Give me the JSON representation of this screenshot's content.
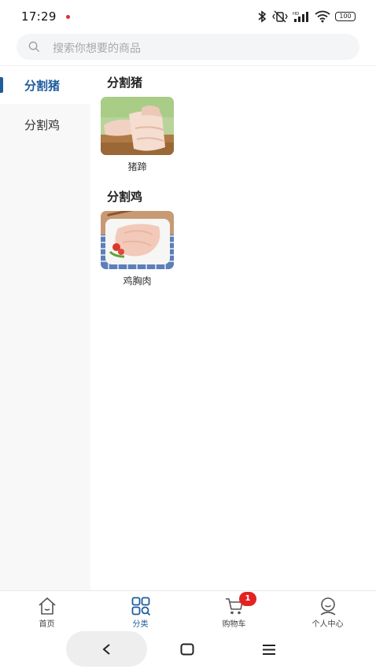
{
  "status_bar": {
    "time": "17:29",
    "battery": "100",
    "icons": [
      "bluetooth-icon",
      "vibrate-off-icon",
      "hd-signal-icon",
      "wifi-icon",
      "battery-icon"
    ],
    "notification_dot_color": "#e0302b"
  },
  "search": {
    "placeholder": "搜索你想要的商品"
  },
  "sidebar": {
    "items": [
      {
        "label": "分割猪",
        "active": true
      },
      {
        "label": "分割鸡",
        "active": false
      }
    ],
    "accent_color": "#1f5c9c"
  },
  "sections": [
    {
      "title": "分割猪",
      "products": [
        {
          "name": "猪蹄",
          "image": "pig-trotters-photo"
        }
      ]
    },
    {
      "title": "分割鸡",
      "products": [
        {
          "name": "鸡胸肉",
          "image": "chicken-breast-photo"
        }
      ]
    }
  ],
  "tabbar": {
    "tabs": [
      {
        "label": "首页",
        "icon": "home-icon",
        "active": false
      },
      {
        "label": "分类",
        "icon": "category-icon",
        "active": true
      },
      {
        "label": "购物车",
        "icon": "cart-icon",
        "active": false
      },
      {
        "label": "个人中心",
        "icon": "profile-icon",
        "active": false
      }
    ],
    "cart_badge": "1",
    "badge_color": "#e32222"
  },
  "system_nav": {
    "icons": [
      "back-icon",
      "home-square-icon",
      "menu-icon"
    ]
  }
}
